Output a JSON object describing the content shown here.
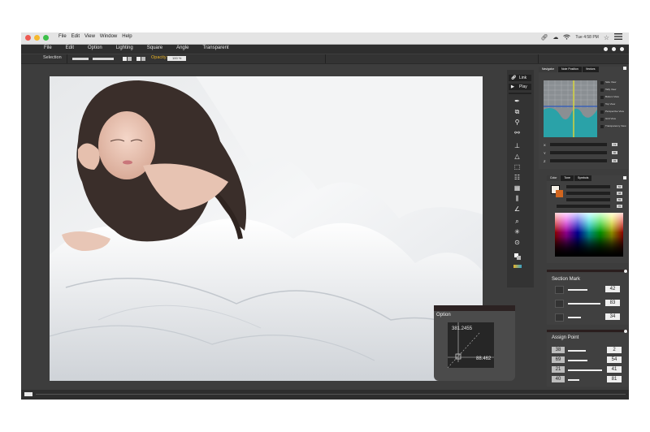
{
  "mac_menu": [
    "File",
    "Edit",
    "View",
    "Window",
    "Help"
  ],
  "clock": "Tue 4:58 PM",
  "app_menu": [
    "File",
    "Edit",
    "Option",
    "Lighting",
    "Square",
    "Angle",
    "Transparent"
  ],
  "options_bar": {
    "selection_label": "Selection",
    "opacity_label": "Opacity:",
    "opacity_value": "100 %"
  },
  "toolbar": {
    "link_label": "Link",
    "play_label": "Play"
  },
  "option_panel": {
    "title": "Option",
    "value_top": "381.2455",
    "value_bottom": "88.462"
  },
  "navigator": {
    "tabs": [
      "Navigator",
      "Note Position",
      "Vectors"
    ],
    "options": [
      "Side View",
      "Tally View",
      "Bottom View",
      "Top View",
      "Perspective View",
      "Grid View",
      "Transparency View"
    ],
    "axes": [
      {
        "label": "X",
        "value": "74"
      },
      {
        "label": "Y",
        "value": "60"
      },
      {
        "label": "Z",
        "value": "33"
      }
    ]
  },
  "color_panel": {
    "tabs": [
      "Color",
      "Tone",
      "Symbols"
    ],
    "channel_values": [
      "62",
      "48",
      "55"
    ],
    "channel_bottom": "70"
  },
  "section_mark": {
    "title": "Section Mark",
    "values": [
      "42",
      "83",
      "34"
    ]
  },
  "assign_point": {
    "title": "Assign Point",
    "rows": [
      {
        "left": "38",
        "right": "2"
      },
      {
        "left": "69",
        "right": "54"
      },
      {
        "left": "21",
        "right": "41"
      },
      {
        "left": "40",
        "right": "81"
      }
    ]
  },
  "colors": {
    "accent": "#e8b227",
    "panel_bg": "#404040",
    "app_bg": "#3d3d3d"
  }
}
